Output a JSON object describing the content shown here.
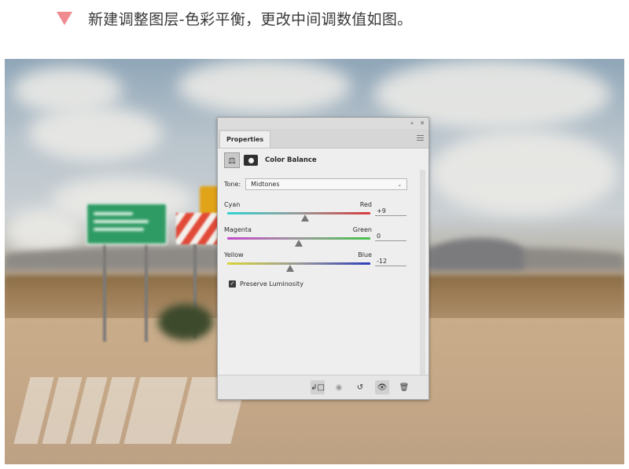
{
  "instruction": {
    "marker_color": "#f08b92",
    "text": "新建调整图层-色彩平衡，更改中间调数值如图。"
  },
  "panel": {
    "collapse_icon": "«",
    "close_icon": "✕",
    "tab_label": "Properties",
    "menu_icon": "panel-menu-icon",
    "adjustment_icon": "balance-scale-icon",
    "mask_icon": "layer-mask-icon",
    "adjustment_title": "Color Balance",
    "tone": {
      "label": "Tone:",
      "selected": "Midtones",
      "arrow": "⌄"
    },
    "balances": [
      {
        "left": "Cyan",
        "right": "Red",
        "value": "+9",
        "value_num": 9,
        "left_color": "#2fd3d0",
        "right_color": "#d83a3a"
      },
      {
        "left": "Magenta",
        "right": "Green",
        "value": "0",
        "value_num": 0,
        "left_color": "#c447c9",
        "right_color": "#45c24a"
      },
      {
        "left": "Yellow",
        "right": "Blue",
        "value": "-12",
        "value_num": -12,
        "left_color": "#d8d53a",
        "right_color": "#2d3db9"
      }
    ],
    "preserve_luminosity": {
      "label": "Preserve Luminosity",
      "checked": true
    },
    "footer_buttons": [
      {
        "icon": "clip-to-layer-icon",
        "glyph": "↲□"
      },
      {
        "icon": "view-previous-state-icon",
        "glyph": "◉"
      },
      {
        "icon": "reset-icon",
        "glyph": "↺"
      },
      {
        "icon": "visibility-eye-icon",
        "glyph": "👁"
      },
      {
        "icon": "trash-icon",
        "glyph": "🗑"
      }
    ]
  }
}
